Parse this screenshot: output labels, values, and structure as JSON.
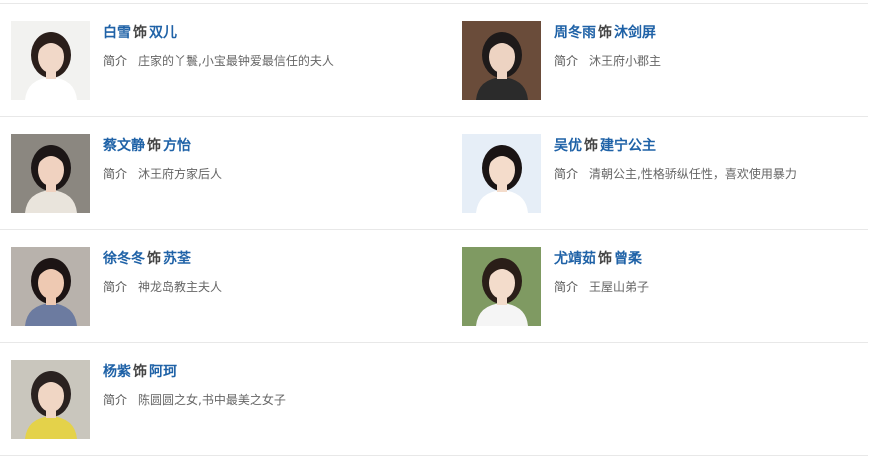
{
  "shi_word": "饰",
  "intro_label": "简介",
  "cast": [
    {
      "actor": "白雪",
      "role": "双儿",
      "intro": "庄家的丫鬟,小宝最钟爱最信任的夫人",
      "photo_colors": [
        "#f2f2f0",
        "#2a1e1a",
        "#f1d8c8",
        "#ffffff"
      ]
    },
    {
      "actor": "周冬雨",
      "role": "沐剑屏",
      "intro": "沐王府小郡主",
      "photo_colors": [
        "#6a4c3a",
        "#1e1a1a",
        "#edd3c2",
        "#2b2b2b"
      ]
    },
    {
      "actor": "蔡文静",
      "role": "方怡",
      "intro": "沐王府方家后人",
      "photo_colors": [
        "#8b8780",
        "#1c1616",
        "#f0d2c0",
        "#e9e4dc"
      ]
    },
    {
      "actor": "吴优",
      "role": "建宁公主",
      "intro": "清朝公主,性格骄纵任性，喜欢使用暴力",
      "photo_colors": [
        "#e6eef7",
        "#1a1414",
        "#f4dccb",
        "#ffffff"
      ]
    },
    {
      "actor": "徐冬冬",
      "role": "苏荃",
      "intro": "神龙岛教主夫人",
      "photo_colors": [
        "#b8b2ac",
        "#1c1414",
        "#eec9b2",
        "#6c7ba0"
      ]
    },
    {
      "actor": "尤靖茹",
      "role": "曾柔",
      "intro": "王屋山弟子",
      "photo_colors": [
        "#7f9a62",
        "#2a1e18",
        "#f3dccb",
        "#f5f5f5"
      ]
    },
    {
      "actor": "杨紫",
      "role": "阿珂",
      "intro": "陈圆圆之女,书中最美之女子",
      "photo_colors": [
        "#c9c6bd",
        "#2a2220",
        "#f0d6c4",
        "#e4d24a"
      ]
    }
  ]
}
